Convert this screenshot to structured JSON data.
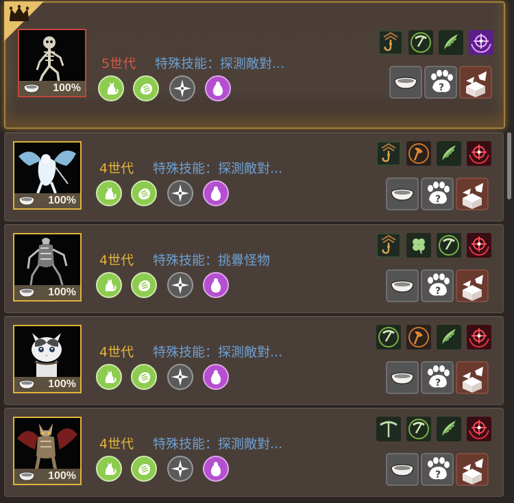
{
  "colors": {
    "gold": "#e4b43a",
    "red_generation": "#d65a47",
    "skill_blue": "#6d9fd0",
    "ability_green": "#7cc04a",
    "ability_purple": "#b54fd0",
    "ability_gray": "#5c5c5c"
  },
  "pets": [
    {
      "featured": true,
      "portrait": "skeleton",
      "satiety": "100%",
      "generation": "5世代",
      "skill": "特殊技能：探測敵對...",
      "abilities": [
        "cat-icon",
        "paw-icon",
        "star-compass-icon",
        "egg-icon"
      ],
      "buffs": [
        "hook-icon",
        "pickaxe-icon",
        "wing-icon",
        "crosshair-icon"
      ],
      "actions": [
        "feed-bowl-button",
        "paw-question-button",
        "release-box-button"
      ]
    },
    {
      "featured": false,
      "portrait": "ice-dragon",
      "satiety": "100%",
      "generation": "4世代",
      "skill": "特殊技能：探測敵對...",
      "abilities": [
        "cat-icon",
        "paw-icon",
        "star-compass-icon",
        "egg-icon"
      ],
      "buffs": [
        "hook-icon",
        "axe-icon",
        "wing-icon",
        "crosshair-icon"
      ],
      "actions": [
        "feed-bowl-button",
        "paw-question-button",
        "release-box-button"
      ]
    },
    {
      "featured": false,
      "portrait": "insect",
      "satiety": "100%",
      "generation": "4世代",
      "skill": "特殊技能：挑釁怪物",
      "abilities": [
        "cat-icon",
        "paw-icon",
        "star-compass-icon",
        "egg-icon"
      ],
      "buffs": [
        "hook-icon",
        "clover-icon",
        "pickaxe-icon",
        "crosshair-icon"
      ],
      "actions": [
        "feed-bowl-button",
        "paw-question-button",
        "release-box-button"
      ]
    },
    {
      "featured": false,
      "portrait": "cat",
      "satiety": "100%",
      "generation": "4世代",
      "skill": "特殊技能：探測敵對...",
      "abilities": [
        "cat-icon",
        "paw-icon",
        "star-compass-icon",
        "egg-icon"
      ],
      "buffs": [
        "pickaxe-icon",
        "axe-icon",
        "wing-icon",
        "crosshair-icon"
      ],
      "actions": [
        "feed-bowl-button",
        "paw-question-button",
        "release-box-button"
      ]
    },
    {
      "featured": false,
      "portrait": "bat-knight",
      "satiety": "100%",
      "generation": "4世代",
      "skill": "特殊技能：探測敵對...",
      "abilities": [
        "cat-icon",
        "paw-icon",
        "star-compass-icon",
        "egg-icon"
      ],
      "buffs": [
        "pick-icon",
        "pickaxe-icon",
        "wing-icon",
        "crosshair-icon"
      ],
      "actions": [
        "feed-bowl-button",
        "paw-question-button",
        "release-box-button"
      ]
    }
  ]
}
